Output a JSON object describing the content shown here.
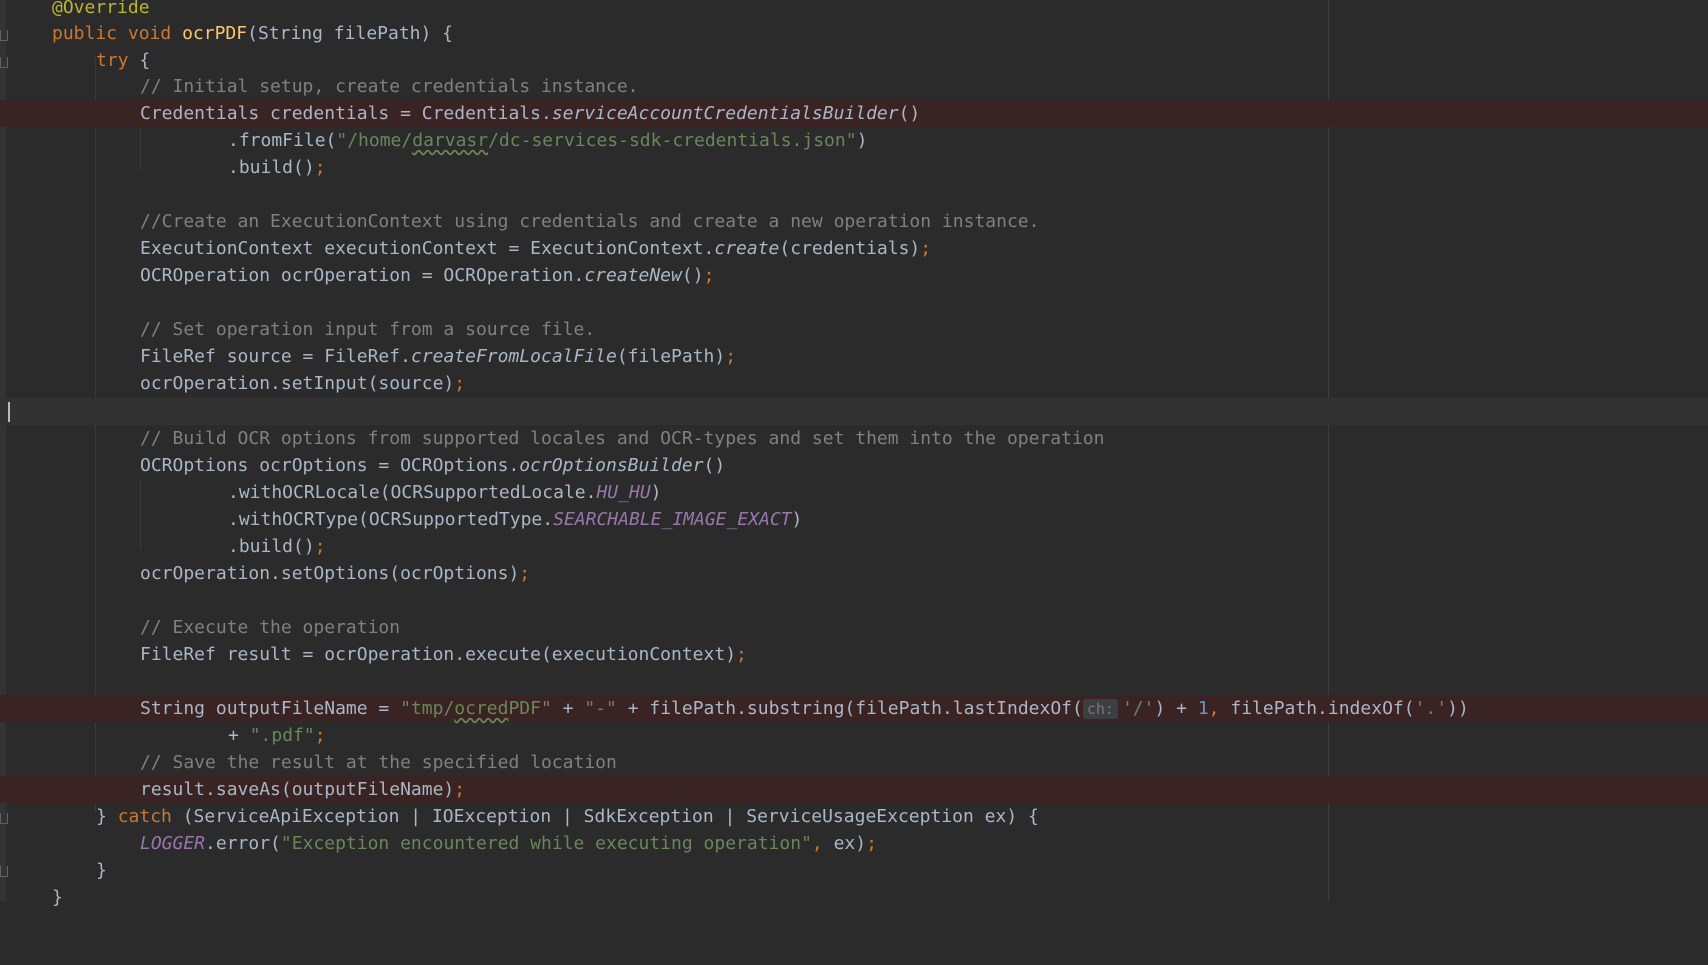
{
  "code": {
    "annotation": "@Override",
    "kw_public": "public",
    "kw_void": "void",
    "method_name": "ocrPDF",
    "signature_rest": "(String filePath) {",
    "kw_try": "try",
    "try_open": " {",
    "comment_setup": "// Initial setup, create credentials instance.",
    "cred_decl": "Credentials credentials = Credentials.",
    "cred_builder": "serviceAccountCredentialsBuilder",
    "parens": "()",
    "from_file_a": ".fromFile(",
    "cred_path_a": "\"/home/",
    "cred_path_user": "darvasr",
    "cred_path_b": "/dc-services-sdk-credentials.json\"",
    "close_paren": ")",
    "build": ".build()",
    "semicolon": ";",
    "comment_context": "//Create an ExecutionContext using credentials and create a new operation instance.",
    "ctx_decl": "ExecutionContext executionContext = ExecutionContext.",
    "ctx_create": "create",
    "ctx_args": "(credentials)",
    "op_decl": "OCROperation ocrOperation = OCROperation.",
    "op_create": "createNew",
    "comment_input": "// Set operation input from a source file.",
    "src_decl": "FileRef source = FileRef.",
    "src_create": "createFromLocalFile",
    "src_args": "(filePath)",
    "set_input": "ocrOperation.setInput(source)",
    "comment_options": "// Build OCR options from supported locales and OCR-types and set them into the operation",
    "opts_decl": "OCROptions ocrOptions = OCROptions.",
    "opts_builder": "ocrOptionsBuilder",
    "with_locale": ".withOCRLocale(OCRSupportedLocale.",
    "locale_const": "HU_HU",
    "with_type": ".withOCRType(OCRSupportedType.",
    "type_const": "SEARCHABLE_IMAGE_EXACT",
    "set_options": "ocrOperation.setOptions(ocrOptions)",
    "comment_execute": "// Execute the operation",
    "result_decl": "FileRef result = ocrOperation.execute(executionContext)",
    "out_decl": "String outputFileName = ",
    "out_str_a": "\"tmp/",
    "out_str_word": "ocred",
    "out_str_b": "PDF\"",
    "plus": " + ",
    "dash_str": "\"-\"",
    "substring_a": "filePath.substring(filePath.lastIndexOf(",
    "param_hint": "ch:",
    "slash_char": "'/'",
    "plus_one_a": ") + ",
    "one": "1",
    "comma": ",",
    "index_of": " filePath.indexOf(",
    "dot_char": "'.'",
    "close_two": "))",
    "plus_pdf_lead": "+ ",
    "pdf_str": "\".pdf\"",
    "comment_save": "// Save the result at the specified location",
    "save_as": "result.saveAs(outputFileName)",
    "catch_close": "} ",
    "kw_catch": "catch",
    "catch_types": " (ServiceApiException | IOException | SdkException | ServiceUsageException ex) {",
    "logger": "LOGGER",
    "logger_call": ".error(",
    "logger_msg": "\"Exception encountered while executing operation\"",
    "logger_end": " ex)",
    "close_brace": "}"
  }
}
